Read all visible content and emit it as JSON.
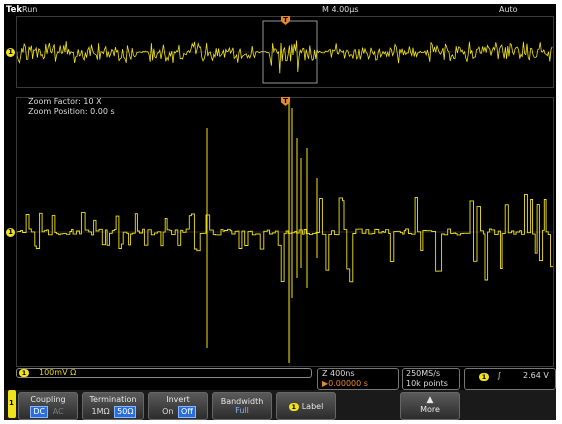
{
  "status_bar": {
    "brand": "Tek",
    "run_state": "Run",
    "timebase": "M 4.00µs",
    "trigger_mode": "Auto"
  },
  "zoom": {
    "factor": "Zoom Factor: 10 X",
    "position": "Zoom Position: 0.00 s"
  },
  "markers": {
    "channel": "1",
    "trigger": "T"
  },
  "readouts": {
    "ch1": "100mV Ω",
    "horizontal_scale": "Z 400ns",
    "horizontal_position": "▶0.00000 s",
    "sample_rate": "250MS/s",
    "record_length": "10k points",
    "trigger_slope": "∫",
    "trigger_level": "2.64 V"
  },
  "menu": {
    "side_tab": "1",
    "coupling": {
      "label": "Coupling",
      "options": [
        "DC",
        "AC"
      ]
    },
    "termination": {
      "label": "Termination",
      "options": [
        "1MΩ",
        "50Ω"
      ]
    },
    "invert": {
      "label": "Invert",
      "options": [
        "On",
        "Off"
      ]
    },
    "bandwidth": {
      "label": "Bandwidth",
      "value": "Full"
    },
    "label_button": "Label",
    "more_button": "More"
  },
  "colors": {
    "trace": "#f1e21b",
    "trigger": "#e8872b",
    "selected": "#2a6fd6",
    "background": "#000000"
  }
}
